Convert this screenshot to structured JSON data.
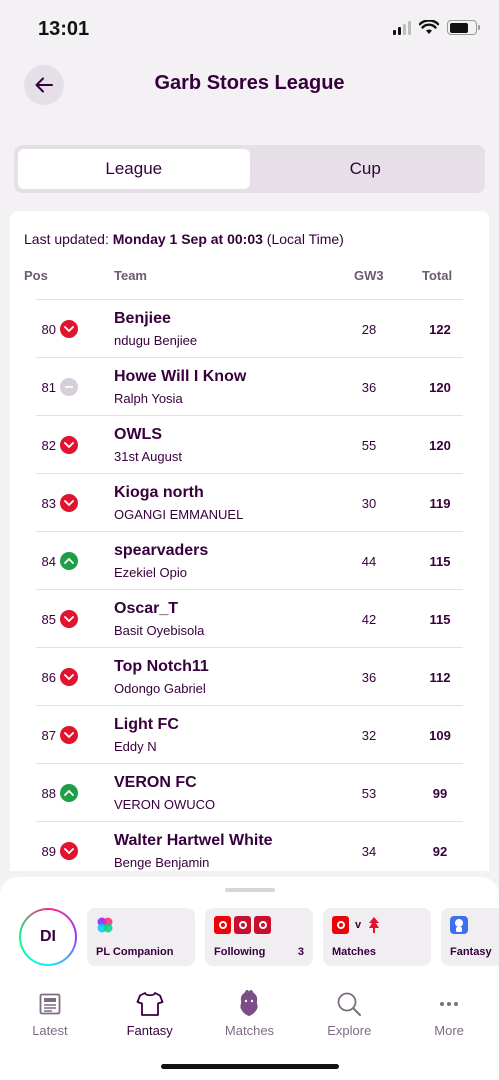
{
  "status": {
    "time": "13:01"
  },
  "header": {
    "title": "Garb Stores League"
  },
  "segmented": {
    "league_label": "League",
    "cup_label": "Cup"
  },
  "updated": {
    "prefix": "Last updated: ",
    "datetime": "Monday 1 Sep at 00:03",
    "suffix": " (Local Time)"
  },
  "table": {
    "columns": {
      "pos": "Pos",
      "team": "Team",
      "gw": "GW3",
      "total": "Total"
    },
    "rows": [
      {
        "pos": "80",
        "movement": "down",
        "team": "Benjiee",
        "manager": "ndugu Benjiee",
        "gw": "28",
        "total": "122"
      },
      {
        "pos": "81",
        "movement": "same",
        "team": "Howe Will I Know",
        "manager": "Ralph Yosia",
        "gw": "36",
        "total": "120"
      },
      {
        "pos": "82",
        "movement": "down",
        "team": "OWLS",
        "manager": "31st August",
        "gw": "55",
        "total": "120"
      },
      {
        "pos": "83",
        "movement": "down",
        "team": "Kioga north",
        "manager": "OGANGI EMMANUEL",
        "gw": "30",
        "total": "119"
      },
      {
        "pos": "84",
        "movement": "up",
        "team": "spearvaders",
        "manager": "Ezekiel Opio",
        "gw": "44",
        "total": "115"
      },
      {
        "pos": "85",
        "movement": "down",
        "team": "Oscar_T",
        "manager": "Basit Oyebisola",
        "gw": "42",
        "total": "115"
      },
      {
        "pos": "86",
        "movement": "down",
        "team": "Top Notch11",
        "manager": "Odongo Gabriel",
        "gw": "36",
        "total": "112"
      },
      {
        "pos": "87",
        "movement": "down",
        "team": "Light FC",
        "manager": "Eddy N",
        "gw": "32",
        "total": "109"
      },
      {
        "pos": "88",
        "movement": "up",
        "team": "VERON FC",
        "manager": "VERON OWUCO",
        "gw": "53",
        "total": "99"
      },
      {
        "pos": "89",
        "movement": "down",
        "team": "Walter Hartwel White",
        "manager": "Benge Benjamin",
        "gw": "34",
        "total": "92"
      }
    ]
  },
  "quick_access": {
    "avatar_initials": "DI",
    "chips": {
      "companion": {
        "label": "PL Companion"
      },
      "following": {
        "label": "Following",
        "count": "3"
      },
      "matches": {
        "label": "Matches",
        "versus": "v"
      },
      "fantasy": {
        "label": "Fantasy"
      }
    }
  },
  "tabbar": {
    "latest": "Latest",
    "fantasy": "Fantasy",
    "matches": "Matches",
    "explore": "Explore",
    "more": "More"
  },
  "colors": {
    "brand_purple": "#37003c",
    "down": "#e0142e",
    "up": "#1f9e4a",
    "same": "#d6ced9"
  }
}
